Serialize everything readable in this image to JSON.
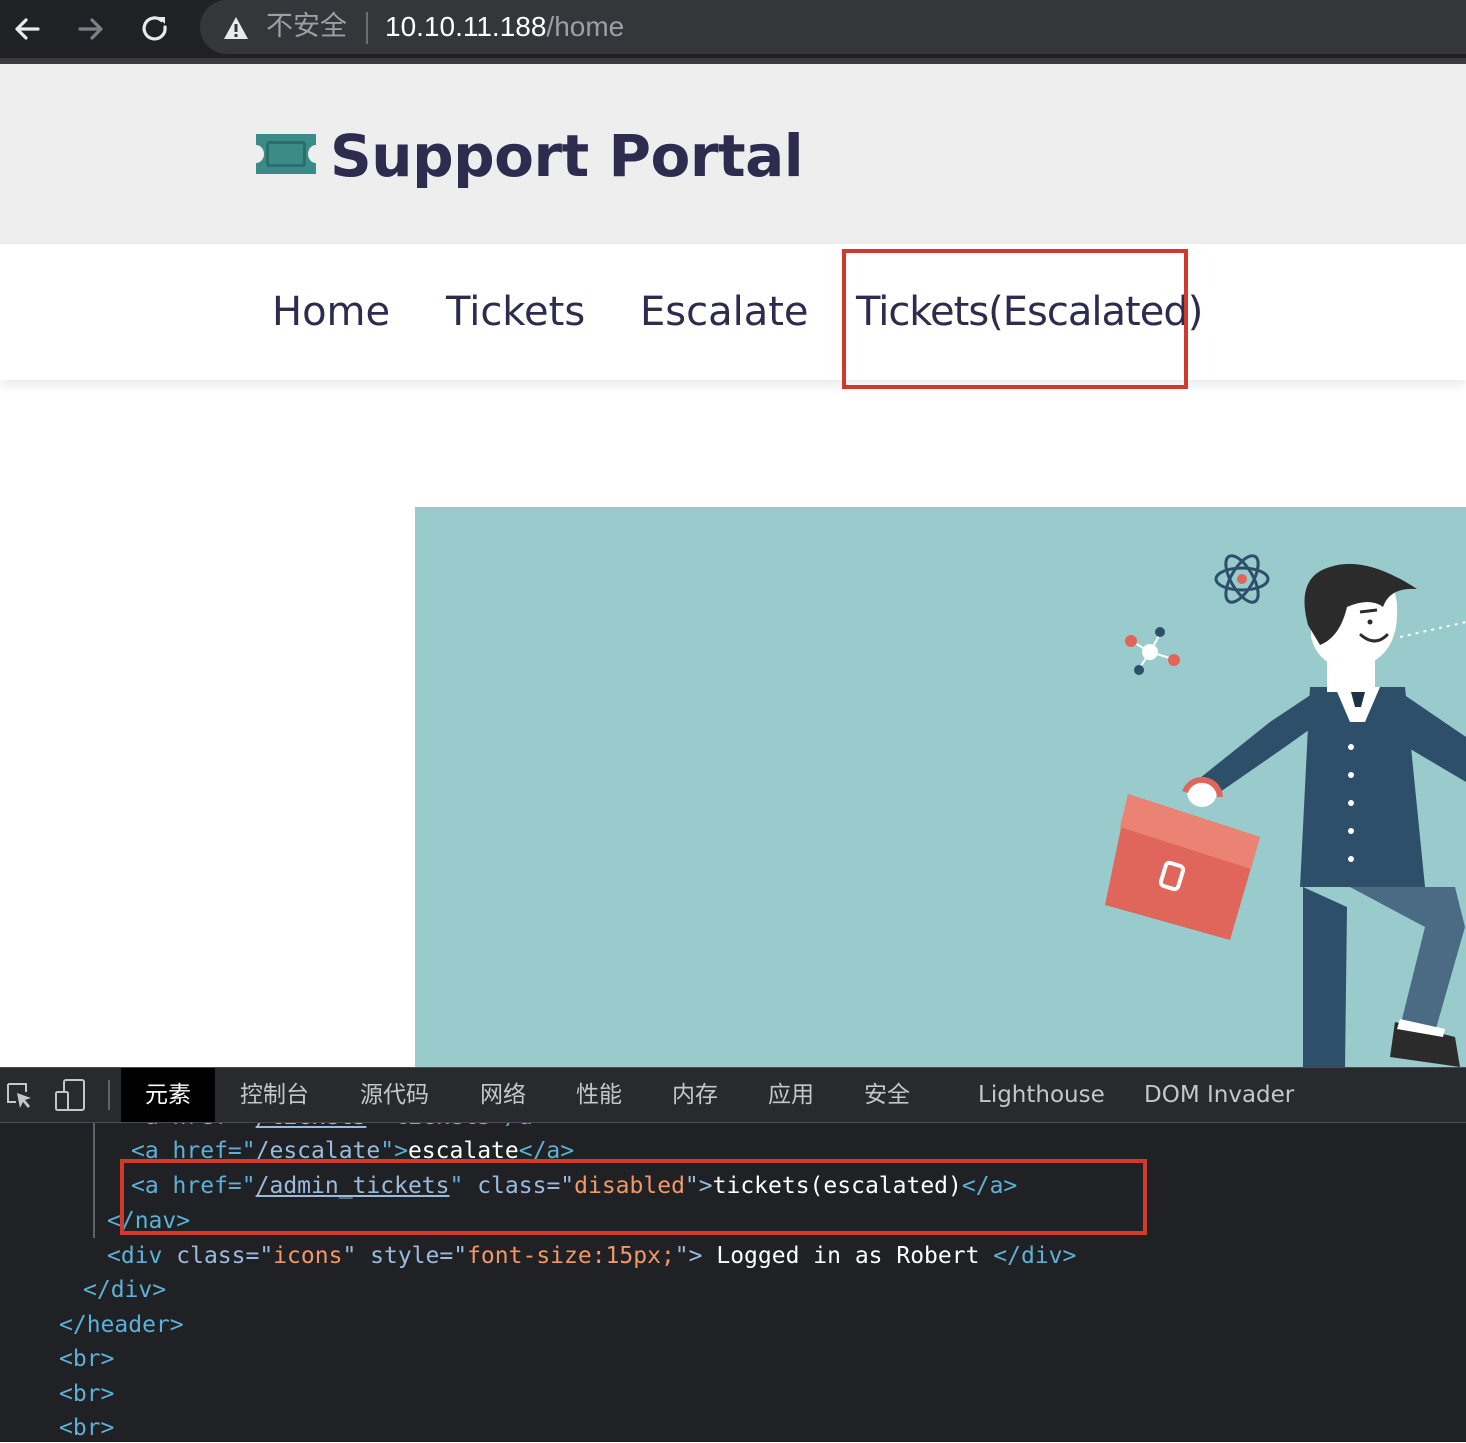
{
  "browser": {
    "insecure_label": "不安全",
    "url_host": "10.10.11.188",
    "url_path": "/home"
  },
  "site": {
    "title": "Support Portal",
    "nav": [
      {
        "label": "Home"
      },
      {
        "label": "Tickets"
      },
      {
        "label": "Escalate"
      },
      {
        "label": "Tickets(Escalated)"
      }
    ],
    "accent_color": "#2d2c4e",
    "hero_color": "#9acbcc",
    "highlight_color": "#d0392b"
  },
  "devtools": {
    "tabs": [
      "元素",
      "控制台",
      "源代码",
      "网络",
      "性能",
      "内存",
      "应用",
      "安全",
      "Lighthouse",
      "DOM Invader"
    ],
    "active_tab": "元素",
    "code": {
      "l0_open": "<a href=\"",
      "l0_href": "/tickets",
      "l0_close": "\">tickets</a>",
      "l1_open": "<a href=\"",
      "l1_href": "/escalate",
      "l1_mid": "\">",
      "l1_text": "escalate",
      "l1_close": "</a>",
      "l2_open": "<a href=\"",
      "l2_href": "/admin_tickets",
      "l2_q": "\" ",
      "l2_attr": "class=\"",
      "l2_val": "disabled",
      "l2_mid": "\">",
      "l2_text": "tickets(escalated)",
      "l2_close": "</a>",
      "l3": "</nav>",
      "l4_open": "<div ",
      "l4_attr1": "class=\"",
      "l4_val1": "icons",
      "l4_q1": "\" ",
      "l4_attr2": "style=\"",
      "l4_val2": "font-size:15px;",
      "l4_mid": "\">",
      "l4_text": " Logged in as Robert ",
      "l4_close": "</div>",
      "l5": "</div>",
      "l6": "</header>",
      "l7": "<br>",
      "l8": "<br>",
      "l9": "<br>"
    }
  }
}
